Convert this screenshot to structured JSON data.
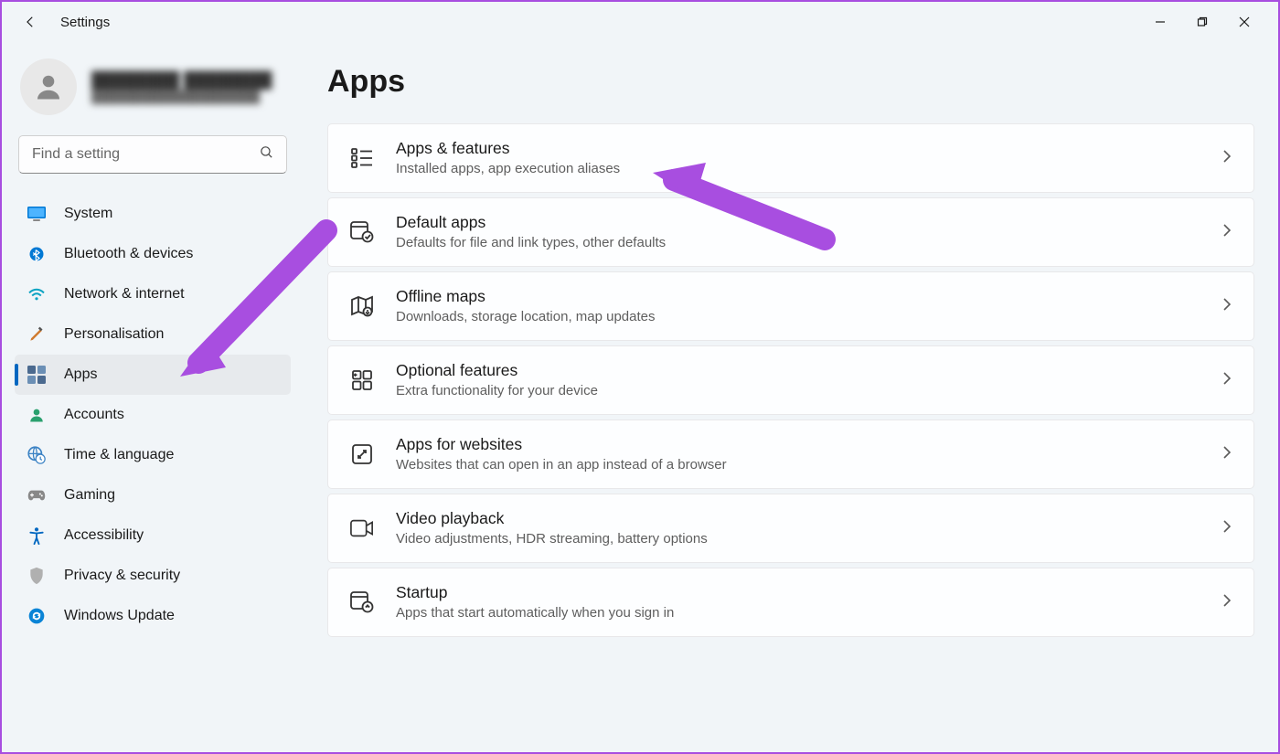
{
  "window": {
    "title": "Settings"
  },
  "search": {
    "placeholder": "Find a setting"
  },
  "nav": {
    "items": [
      {
        "id": "system",
        "label": "System",
        "icon": "monitor-icon",
        "color": "#0078d4"
      },
      {
        "id": "bluetooth",
        "label": "Bluetooth & devices",
        "icon": "bluetooth-icon",
        "color": "#0078d4"
      },
      {
        "id": "network",
        "label": "Network & internet",
        "icon": "wifi-icon",
        "color": "#0aa3c2"
      },
      {
        "id": "personalisation",
        "label": "Personalisation",
        "icon": "paintbrush-icon",
        "color": "#d07a2e"
      },
      {
        "id": "apps",
        "label": "Apps",
        "icon": "apps-icon",
        "color": "#4b6a8f",
        "active": true
      },
      {
        "id": "accounts",
        "label": "Accounts",
        "icon": "person-icon",
        "color": "#2aa06e"
      },
      {
        "id": "time",
        "label": "Time & language",
        "icon": "globe-clock-icon",
        "color": "#3b82c4"
      },
      {
        "id": "gaming",
        "label": "Gaming",
        "icon": "gamepad-icon",
        "color": "#888"
      },
      {
        "id": "accessibility",
        "label": "Accessibility",
        "icon": "accessibility-icon",
        "color": "#0067c0"
      },
      {
        "id": "privacy",
        "label": "Privacy & security",
        "icon": "shield-icon",
        "color": "#999"
      },
      {
        "id": "update",
        "label": "Windows Update",
        "icon": "update-icon",
        "color": "#0a84d6"
      }
    ]
  },
  "page": {
    "title": "Apps",
    "cards": [
      {
        "id": "apps-features",
        "title": "Apps & features",
        "sub": "Installed apps, app execution aliases",
        "icon": "list-icon"
      },
      {
        "id": "default-apps",
        "title": "Default apps",
        "sub": "Defaults for file and link types, other defaults",
        "icon": "default-apps-icon"
      },
      {
        "id": "offline-maps",
        "title": "Offline maps",
        "sub": "Downloads, storage location, map updates",
        "icon": "map-icon"
      },
      {
        "id": "optional-features",
        "title": "Optional features",
        "sub": "Extra functionality for your device",
        "icon": "grid-plus-icon"
      },
      {
        "id": "apps-websites",
        "title": "Apps for websites",
        "sub": "Websites that can open in an app instead of a browser",
        "icon": "link-app-icon"
      },
      {
        "id": "video-playback",
        "title": "Video playback",
        "sub": "Video adjustments, HDR streaming, battery options",
        "icon": "video-icon"
      },
      {
        "id": "startup",
        "title": "Startup",
        "sub": "Apps that start automatically when you sign in",
        "icon": "startup-icon"
      }
    ]
  },
  "annotations": {
    "arrows": [
      {
        "target": "sidebar-item-apps"
      },
      {
        "target": "card-apps-features"
      }
    ],
    "color": "#a84ee0"
  }
}
